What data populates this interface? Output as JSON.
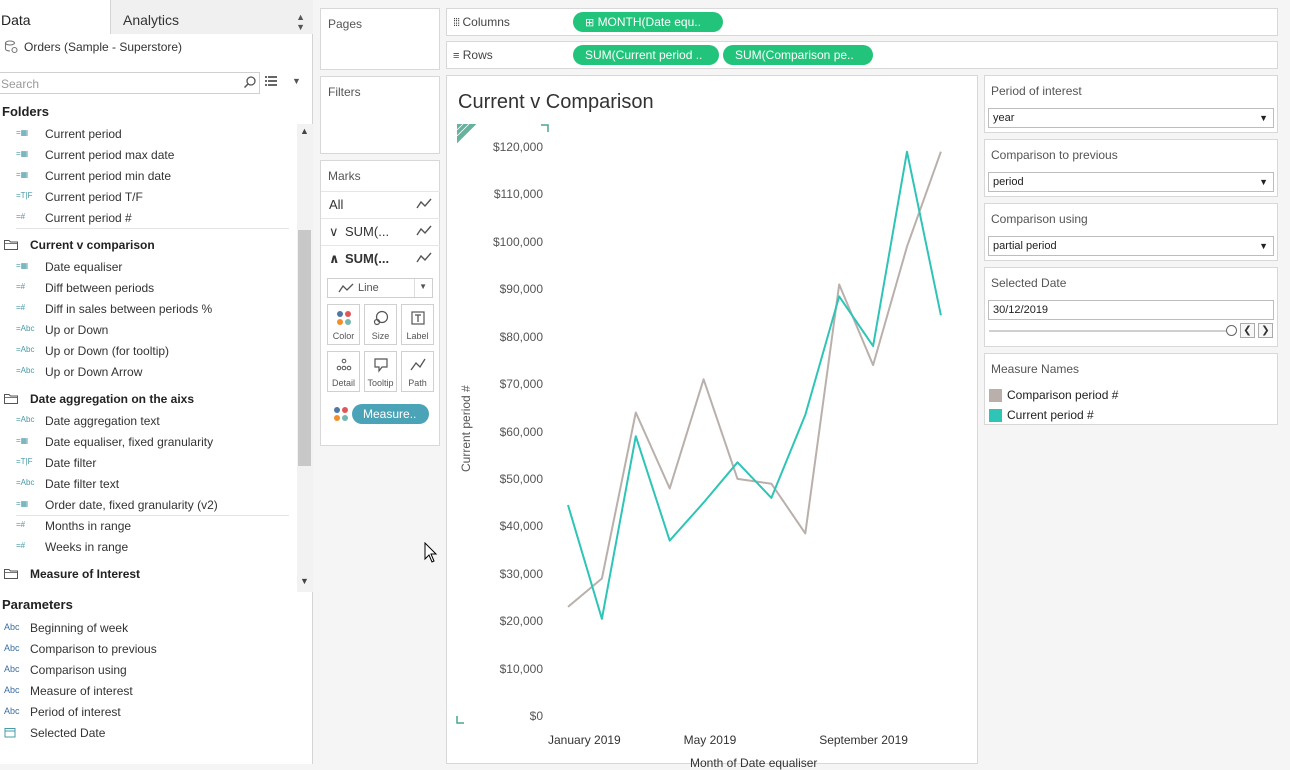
{
  "left_pane": {
    "tab_data": "Data",
    "tab_analytics": "Analytics",
    "datasource": "Orders (Sample - Superstore)",
    "search_placeholder": "Search",
    "folders_title": "Folders",
    "folder_items": [
      {
        "kind": "field",
        "icon": "=▦",
        "label": "Current period"
      },
      {
        "kind": "field",
        "icon": "=▦",
        "label": "Current period max date"
      },
      {
        "kind": "field",
        "icon": "=▦",
        "label": "Current period min date"
      },
      {
        "kind": "field",
        "icon": "=T|F",
        "label": "Current period T/F"
      },
      {
        "kind": "field",
        "icon": "=#",
        "label": "Current period #"
      },
      {
        "kind": "folder",
        "label": "Current v comparison"
      },
      {
        "kind": "field",
        "icon": "=▦",
        "label": "Date equaliser"
      },
      {
        "kind": "field",
        "icon": "=#",
        "label": "Diff between periods"
      },
      {
        "kind": "field",
        "icon": "=#",
        "label": "Diff in sales between periods %"
      },
      {
        "kind": "field",
        "icon": "=Abc",
        "label": "Up or Down"
      },
      {
        "kind": "field",
        "icon": "=Abc",
        "label": "Up or Down (for tooltip)"
      },
      {
        "kind": "field",
        "icon": "=Abc",
        "label": "Up or Down Arrow"
      },
      {
        "kind": "folder",
        "label": "Date aggregation on the aixs"
      },
      {
        "kind": "field",
        "icon": "=Abc",
        "label": "Date aggregation text"
      },
      {
        "kind": "field",
        "icon": "=▦",
        "label": "Date equaliser, fixed granularity"
      },
      {
        "kind": "field",
        "icon": "=T|F",
        "label": "Date filter"
      },
      {
        "kind": "field",
        "icon": "=Abc",
        "label": "Date filter text"
      },
      {
        "kind": "field",
        "icon": "=▦",
        "label": "Order date, fixed granularity (v2)"
      },
      {
        "kind": "field",
        "icon": "=#",
        "label": "Months in range"
      },
      {
        "kind": "field",
        "icon": "=#",
        "label": "Weeks in range"
      },
      {
        "kind": "folder",
        "label": "Measure of Interest"
      }
    ],
    "parameters_title": "Parameters",
    "parameters": [
      {
        "icon": "Abc",
        "label": "Beginning of week"
      },
      {
        "icon": "Abc",
        "label": "Comparison to previous"
      },
      {
        "icon": "Abc",
        "label": "Comparison using"
      },
      {
        "icon": "Abc",
        "label": "Measure of interest"
      },
      {
        "icon": "Abc",
        "label": "Period of interest"
      },
      {
        "icon": "cal",
        "label": "Selected Date"
      }
    ]
  },
  "shelves": {
    "pages": "Pages",
    "filters": "Filters",
    "marks": "Marks",
    "marks_rows": [
      "All",
      "SUM(...",
      "SUM(..."
    ],
    "mark_type": "Line",
    "mark_buttons": [
      "Color",
      "Size",
      "Label",
      "Detail",
      "Tooltip",
      "Path"
    ],
    "measure_pill": "Measure..",
    "columns_label": "Columns",
    "rows_label": "Rows",
    "columns_pill": "MONTH(Date equ..",
    "rows_pills": [
      "SUM(Current period ..",
      "SUM(Comparison pe.."
    ]
  },
  "viz": {
    "title": "Current v Comparison",
    "x_axis_title": "Month of Date equaliser",
    "y_axis_title": "Current period #"
  },
  "right_pane": {
    "period_of_interest": {
      "title": "Period of interest",
      "value": "year"
    },
    "comparison_to_previous": {
      "title": "Comparison to previous",
      "value": "period"
    },
    "comparison_using": {
      "title": "Comparison using",
      "value": "partial period"
    },
    "selected_date": {
      "title": "Selected Date",
      "value": "30/12/2019"
    },
    "legend_title": "Measure Names",
    "legend_items": [
      "Comparison period #",
      "Current period #"
    ]
  },
  "colors": {
    "current": "#2ec4b6",
    "comparison": "#b9b0ac",
    "pill_green": "#22c37a",
    "measure_pill": "#4ba3b8"
  },
  "chart_data": {
    "type": "line",
    "categories": [
      "January 2019",
      "February 2019",
      "March 2019",
      "April 2019",
      "May 2019",
      "June 2019",
      "July 2019",
      "August 2019",
      "September 2019",
      "October 2019",
      "November 2019",
      "December 2019"
    ],
    "x_tick_labels": [
      "January 2019",
      "May 2019",
      "September 2019"
    ],
    "ylabel": "Current period #",
    "xlabel": "Month of Date equaliser",
    "ylim": [
      0,
      120000
    ],
    "y_ticks": [
      "$0",
      "$10,000",
      "$20,000",
      "$30,000",
      "$40,000",
      "$50,000",
      "$60,000",
      "$70,000",
      "$80,000",
      "$90,000",
      "$100,000",
      "$110,000",
      "$120,000"
    ],
    "y_tick_values": [
      0,
      10000,
      20000,
      30000,
      40000,
      50000,
      60000,
      70000,
      80000,
      90000,
      100000,
      110000,
      120000
    ],
    "series": [
      {
        "name": "Comparison period #",
        "values": [
          23000,
          29000,
          64000,
          48000,
          71000,
          50000,
          49000,
          38500,
          91000,
          74000,
          99000,
          119000
        ]
      },
      {
        "name": "Current period #",
        "values": [
          44500,
          20500,
          59000,
          37000,
          45000,
          53500,
          46000,
          63500,
          88500,
          78000,
          119000,
          84500
        ]
      }
    ],
    "grid": false,
    "legend": "right"
  }
}
